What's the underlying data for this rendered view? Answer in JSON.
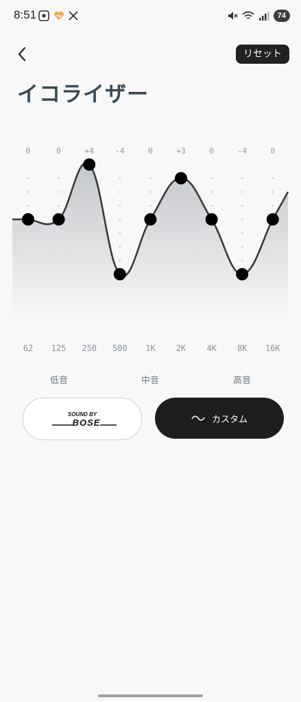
{
  "status_bar": {
    "time": "8:51",
    "battery": "74",
    "left_icons": [
      "screenshot-icon",
      "health-heart-icon",
      "x-logo-icon"
    ],
    "right_icons": [
      "mute-icon",
      "wifi-icon",
      "signal-icon",
      "battery-icon"
    ]
  },
  "header": {
    "back_icon": "chevron-left-icon",
    "reset_label": "リセット"
  },
  "page": {
    "title": "イコライザー"
  },
  "equalizer": {
    "bands": [
      {
        "freq": "62",
        "gain_label": "0",
        "gain": 0
      },
      {
        "freq": "125",
        "gain_label": "0",
        "gain": 0
      },
      {
        "freq": "250",
        "gain_label": "+4",
        "gain": 4
      },
      {
        "freq": "500",
        "gain_label": "-4",
        "gain": -4
      },
      {
        "freq": "1K",
        "gain_label": "0",
        "gain": 0
      },
      {
        "freq": "2K",
        "gain_label": "+3",
        "gain": 3
      },
      {
        "freq": "4K",
        "gain_label": "0",
        "gain": 0
      },
      {
        "freq": "8K",
        "gain_label": "-4",
        "gain": -4
      },
      {
        "freq": "16K",
        "gain_label": "0",
        "gain": 0
      }
    ],
    "gain_range": [
      -6,
      6
    ],
    "ranges": [
      "低音",
      "中音",
      "高音"
    ],
    "curve_color": "#3a3a3a",
    "knob_color": "#000000"
  },
  "presets": {
    "bose": {
      "logo_line1": "SOUND BY",
      "logo_line2": "BOSE",
      "selected": false
    },
    "custom": {
      "label": "カスタム",
      "icon": "wave-icon",
      "selected": true
    }
  }
}
